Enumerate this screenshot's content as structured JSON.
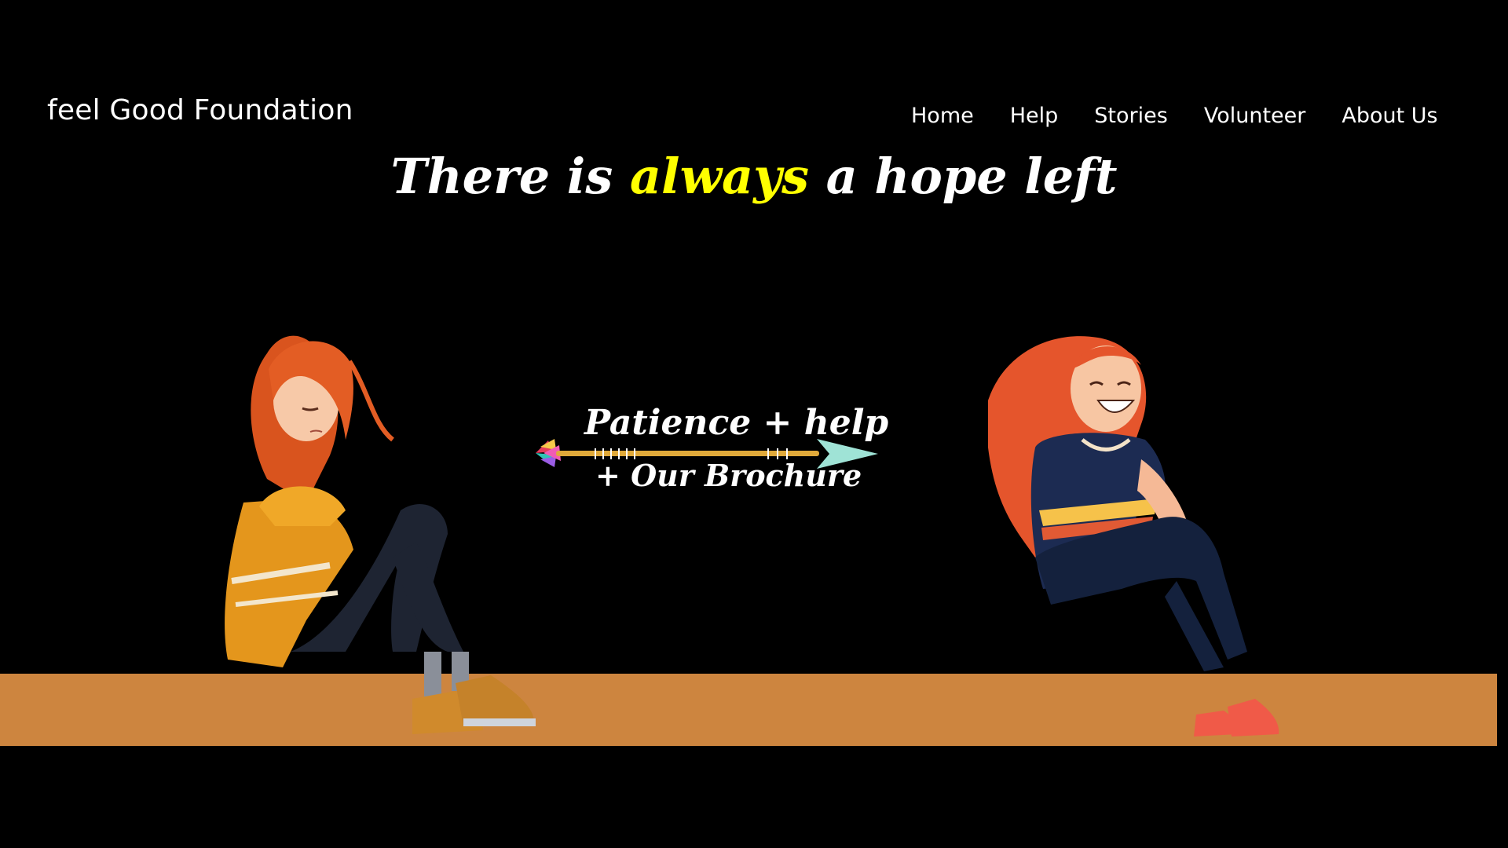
{
  "header": {
    "brand": "feel Good Foundation"
  },
  "nav": {
    "items": [
      {
        "label": "Home"
      },
      {
        "label": "Help"
      },
      {
        "label": "Stories"
      },
      {
        "label": "Volunteer"
      },
      {
        "label": "About Us"
      }
    ]
  },
  "hero": {
    "before": "There is ",
    "accent": "always",
    "after": " a hope left"
  },
  "cta": {
    "line1": "Patience + help",
    "line2": "+ Our Brochure"
  },
  "colors": {
    "background": "#000000",
    "accent": "#ffff00",
    "floor": "#cd853f",
    "text": "#ffffff"
  }
}
